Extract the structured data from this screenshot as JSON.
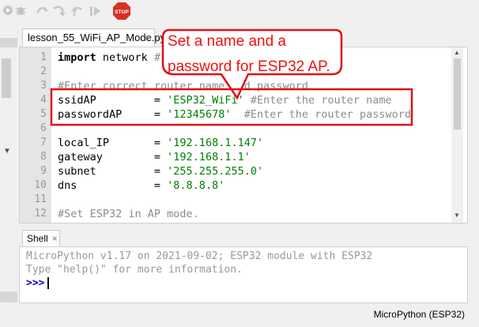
{
  "toolbar": {
    "icons": [
      "run-icon",
      "debug-icon",
      "step-over-icon",
      "step-into-icon",
      "step-out-icon",
      "resume-icon",
      "stop-icon"
    ],
    "stop_label": "STOP"
  },
  "editor": {
    "tab_label": "lesson_55_WiFi_AP_Mode.py",
    "tab_close": "×",
    "line_numbers": [
      "1",
      "2",
      "3",
      "4",
      "5",
      "6",
      "7",
      "8",
      "9",
      "10",
      "11",
      "12"
    ],
    "lines": {
      "l1_kw": "import",
      "l1_mod": " network ",
      "l1_cmt": "#Import network module",
      "l3_cmt": "#Enter correct router name and password",
      "l4_name": "ssidAP         = ",
      "l4_str": "'ESP32_WiFi'",
      "l4_cmt": " #Enter the router name",
      "l5_name": "passwordAP     = ",
      "l5_str": "'12345678'",
      "l5_cmt": "  #Enter the router password",
      "l7_name": "local_IP       = ",
      "l7_str": "'192.168.1.147'",
      "l8_name": "gateway        = ",
      "l8_str": "'192.168.1.1'",
      "l9_name": "subnet         = ",
      "l9_str": "'255.255.255.0'",
      "l10_name": "dns            = ",
      "l10_str": "'8.8.8.8'",
      "l12_cmt": "#Set ESP32 in AP mode."
    }
  },
  "shell": {
    "tab_label": "Shell",
    "tab_close": "×",
    "line1": "MicroPython v1.17 on 2021-09-02; ESP32 module with ESP32",
    "line2": "Type \"help()\" for more information.",
    "prompt": ">>>"
  },
  "status": {
    "interpreter": "MicroPython (ESP32)"
  },
  "annotation": {
    "text_line1": "Set a name and a",
    "text_line2": "password for ESP32 AP.",
    "color": "#e11111"
  }
}
